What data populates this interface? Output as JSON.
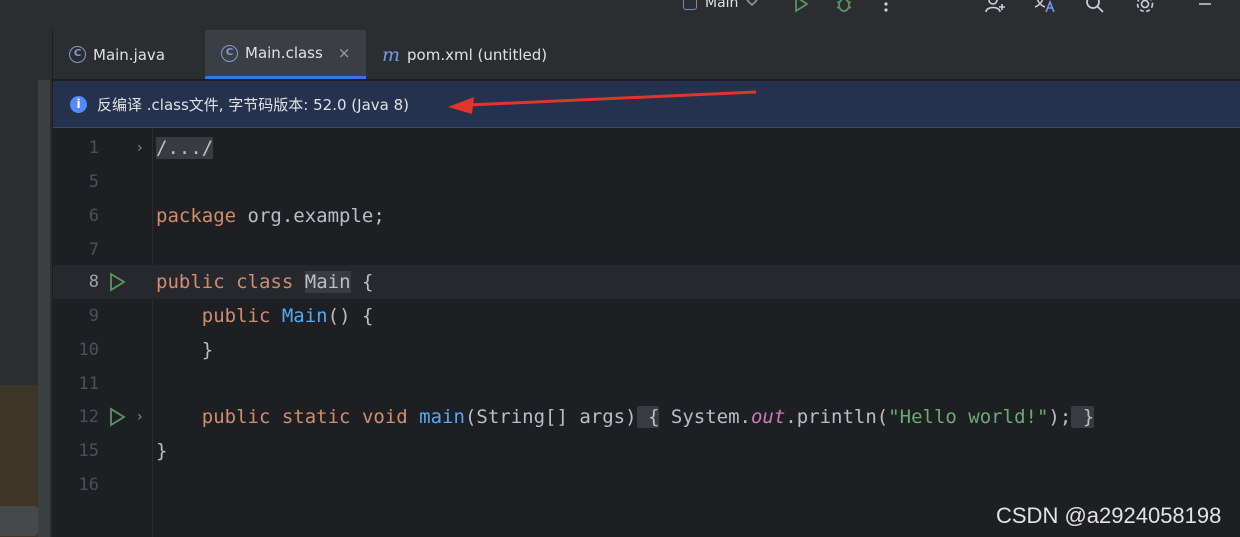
{
  "toolbar": {
    "run_config": "Main",
    "icons": [
      "run-icon",
      "debug-icon",
      "more-icon",
      "add-user-icon",
      "translate-icon",
      "search-icon",
      "settings-icon",
      "minimize-icon"
    ]
  },
  "tabs": [
    {
      "label": "Main.java",
      "icon": "class-icon"
    },
    {
      "label": "Main.class",
      "icon": "class-icon",
      "close": "×"
    },
    {
      "label": "pom.xml (untitled)",
      "icon": "maven-icon"
    }
  ],
  "banner": {
    "text": "反编译 .class文件, 字节码版本: 52.0 (Java 8)",
    "icon": "info-icon"
  },
  "code": {
    "line_numbers": [
      "1",
      "5",
      "6",
      "7",
      "8",
      "9",
      "10",
      "11",
      "12",
      "15",
      "16"
    ],
    "folded_imports": "/.../",
    "package_kw": "package",
    "package_name": " org.example;",
    "public_kw": "public",
    "class_kw": "class",
    "class_name": "Main",
    "open_brace": " {",
    "indent": "    ",
    "ctor_name": "Main",
    "ctor_parens": "() {",
    "close_brace_indented": "    }",
    "static_kw": "static",
    "void_kw": "void",
    "main_name": "main",
    "main_params": "(String[] args)",
    "fold_open": " {",
    "stmt_system": "System.",
    "stmt_out": "out",
    "stmt_println": ".println(",
    "stmt_string": "\"Hello world!\"",
    "stmt_end": ");",
    "fold_close": " }",
    "close_brace": "}"
  },
  "watermark": "CSDN @a2924058198",
  "colors": {
    "keyword": "#cf8e6d",
    "function": "#56a8f5",
    "string": "#6aab73",
    "field": "#c77dbb",
    "accent": "#3574f0",
    "arrow": "#e0342c"
  }
}
